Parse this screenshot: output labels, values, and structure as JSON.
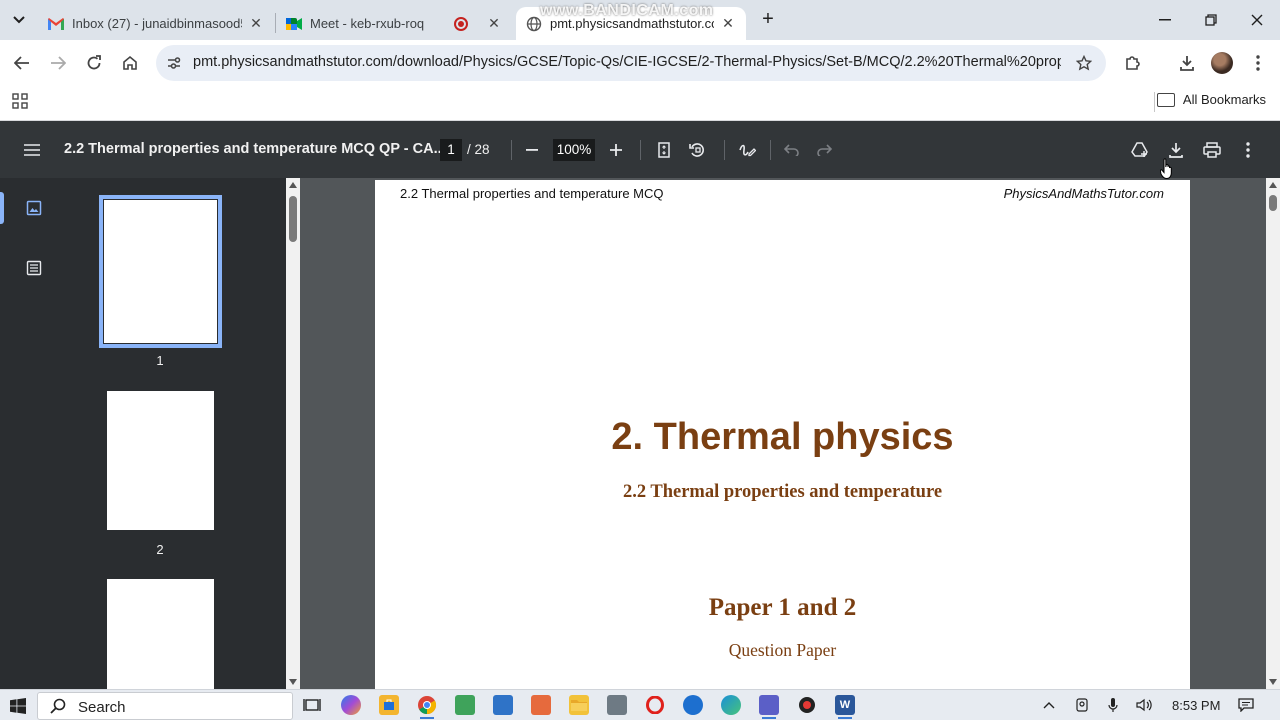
{
  "browser": {
    "tabs": [
      {
        "title": "Inbox (27) - junaidbinmasood5",
        "icon": "gmail-icon",
        "active": false
      },
      {
        "title": "Meet - keb-rxub-roq",
        "icon": "google-meet-icon",
        "active": false,
        "recording": true
      },
      {
        "title": "pmt.physicsandmathstutor.com",
        "icon": "globe-icon",
        "active": true
      }
    ],
    "watermark": "www.BANDICAM.com",
    "url": "pmt.physicsandmathstutor.com/download/Physics/GCSE/Topic-Qs/CIE-IGCSE/2-Thermal-Physics/Set-B/MCQ/2.2%20Thermal%20propertie...",
    "bookmarks_label": "All Bookmarks"
  },
  "pdf": {
    "title": "2.2 Thermal properties and temperature MCQ QP - CA...",
    "current_page": "1",
    "total_pages": "/ 28",
    "zoom": "100%",
    "thumbnails": [
      "1",
      "2"
    ],
    "page": {
      "header_left": "2.2 Thermal properties and temperature  MCQ",
      "header_right": "PhysicsAndMathsTutor.com",
      "title": "2. Thermal physics",
      "subtitle": "2.2 Thermal properties and temperature",
      "paper": "Paper 1 and 2",
      "paper_type": "Question Paper"
    }
  },
  "taskbar": {
    "search_placeholder": "Search",
    "clock": "8:53 PM"
  },
  "colors": {
    "heading_brown": "#7a3f12",
    "pdf_toolbar": "#323639",
    "accent_blue": "#8ab4f8"
  }
}
